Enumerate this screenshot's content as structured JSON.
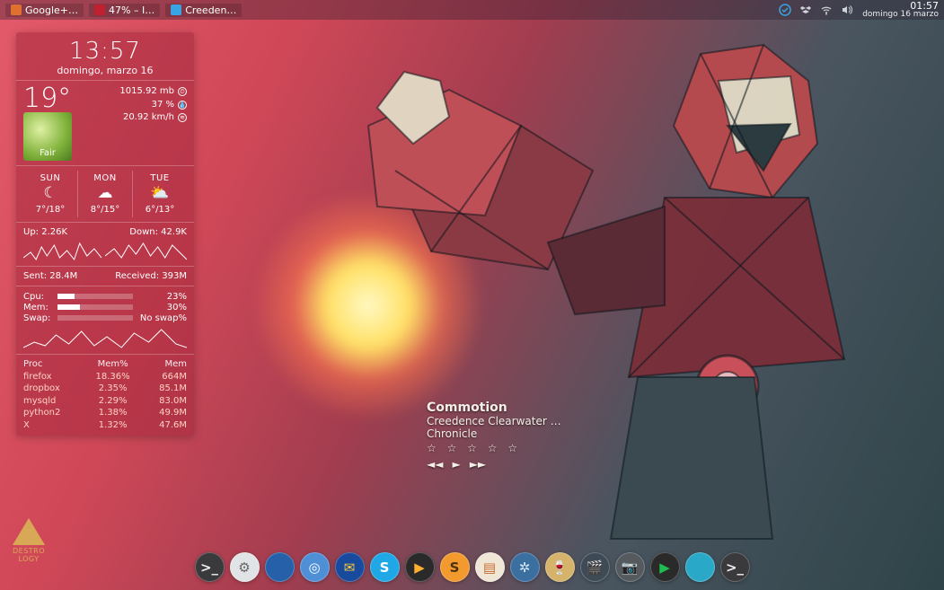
{
  "panel": {
    "tasks": [
      {
        "label": "Google+…",
        "icon_bg": "#e07030"
      },
      {
        "label": "47% – I…",
        "icon_bg": "#c02030"
      },
      {
        "label": "Creeden…",
        "icon_bg": "#3aa3e3"
      }
    ],
    "clock": {
      "time": "01:57",
      "date": "domingo 16 marzo"
    }
  },
  "widget": {
    "time": "13:57",
    "date": "domingo, marzo 16",
    "now": {
      "temp": "19°",
      "cond": "Fair",
      "pressure": "1015.92 mb",
      "humidity": "37 %",
      "wind": "20.92 km/h"
    },
    "forecast": [
      {
        "day": "SUN",
        "icon": "☾",
        "range": "7°/18°"
      },
      {
        "day": "MON",
        "icon": "☁",
        "range": "8°/15°"
      },
      {
        "day": "TUE",
        "icon": "⛅",
        "range": "6°/13°"
      }
    ],
    "net": {
      "up": "Up: 2.26K",
      "down": "Down: 42.9K",
      "sent": "Sent: 28.4M",
      "recv": "Received: 393M"
    },
    "sys": [
      {
        "k": "Cpu:",
        "pct": 23,
        "v": "23%"
      },
      {
        "k": "Mem:",
        "pct": 30,
        "v": "30%"
      },
      {
        "k": "Swap:",
        "pct": 0,
        "v": "No swap%"
      }
    ],
    "proc_headers": [
      "Proc",
      "Mem%",
      "Mem"
    ],
    "procs": [
      {
        "name": "firefox",
        "mempct": "18.36%",
        "mem": "664M"
      },
      {
        "name": "dropbox",
        "mempct": "2.35%",
        "mem": "85.1M"
      },
      {
        "name": "mysqld",
        "mempct": "2.29%",
        "mem": "83.0M"
      },
      {
        "name": "python2",
        "mempct": "1.38%",
        "mem": "49.9M"
      },
      {
        "name": "X",
        "mempct": "1.32%",
        "mem": "47.6M"
      }
    ]
  },
  "nowplaying": {
    "title": "Commotion",
    "artist": "Creedence Clearwater …",
    "album": "Chronicle",
    "stars": "☆ ☆ ☆ ☆ ☆"
  },
  "logo": {
    "line1": "DESTRO",
    "line2": "LOGY"
  },
  "dock": [
    {
      "name": "terminal",
      "bg": "#3a3a3c",
      "glyph": ">_",
      "fg": "#eee"
    },
    {
      "name": "prefs",
      "bg": "#e1e4e6",
      "glyph": "⚙",
      "fg": "#666"
    },
    {
      "name": "firefox",
      "bg": "#2560a8",
      "glyph": "",
      "fg": "#ff9a2e"
    },
    {
      "name": "chromium",
      "bg": "#4f8fd6",
      "glyph": "◎",
      "fg": "#fff"
    },
    {
      "name": "mail",
      "bg": "#184a9e",
      "glyph": "✉",
      "fg": "#ffcc33"
    },
    {
      "name": "skype",
      "bg": "#1fa7e6",
      "glyph": "S",
      "fg": "#fff"
    },
    {
      "name": "media-player",
      "bg": "#2a2a2a",
      "glyph": "▶",
      "fg": "#ffb030"
    },
    {
      "name": "sublime",
      "bg": "#f29a2e",
      "glyph": "S",
      "fg": "#4a3210"
    },
    {
      "name": "file-manager",
      "bg": "#efe6d6",
      "glyph": "▤",
      "fg": "#c76b2e"
    },
    {
      "name": "spiral-app",
      "bg": "#3a6fa0",
      "glyph": "✲",
      "fg": "#d4e6f5"
    },
    {
      "name": "wine",
      "bg": "#d6b36a",
      "glyph": "🍷",
      "fg": "#6a1020"
    },
    {
      "name": "video-editor",
      "bg": "#3e4a55",
      "glyph": "🎬",
      "fg": "#d0d6da"
    },
    {
      "name": "screenshot",
      "bg": "#555a5e",
      "glyph": "📷",
      "fg": "#d0d6da"
    },
    {
      "name": "emerald",
      "bg": "#2a2a2a",
      "glyph": "▶",
      "fg": "#1fbf4f"
    },
    {
      "name": "globe",
      "bg": "#2aa8c8",
      "glyph": "",
      "fg": "#fff"
    },
    {
      "name": "terminal-2",
      "bg": "#3a3a3c",
      "glyph": ">_",
      "fg": "#eee"
    }
  ]
}
